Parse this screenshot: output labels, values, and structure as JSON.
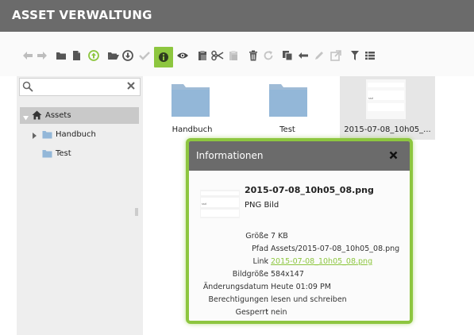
{
  "app": {
    "title": "ASSET VERWALTUNG"
  },
  "colors": {
    "accent": "#8dc63f",
    "header": "#6b6b6b",
    "sidebar": "#eeeeee"
  },
  "toolbar": {
    "buttons": [
      "back-icon",
      "forward-icon",
      "folder-icon",
      "file-icon",
      "upload-icon",
      "folder-open-icon",
      "download-icon",
      "check-icon",
      "info-icon",
      "eye-icon",
      "paste-icon",
      "cut-icon",
      "paste-disabled-icon",
      "trash-icon",
      "refresh-icon",
      "copy-icon",
      "rename-icon",
      "edit-icon",
      "resize-icon",
      "filter-icon",
      "list-view-icon"
    ],
    "active": "info-icon"
  },
  "sidebar": {
    "search": {
      "placeholder": "",
      "value": ""
    },
    "tree": {
      "root": {
        "label": "Assets",
        "expanded": true
      },
      "children": [
        {
          "label": "Handbuch",
          "has_children": true
        },
        {
          "label": "Test",
          "has_children": false
        }
      ]
    }
  },
  "files": [
    {
      "name": "Handbuch",
      "kind": "folder"
    },
    {
      "name": "Test",
      "kind": "folder"
    },
    {
      "name": "2015-07-08_10h05_...",
      "kind": "image",
      "selected": true
    }
  ],
  "dialog": {
    "title": "Informationen",
    "file_name": "2015-07-08_10h05_08.png",
    "file_type": "PNG Bild",
    "properties": [
      {
        "label": "Größe",
        "value": "7 KB",
        "link": false
      },
      {
        "label": "Pfad",
        "value": "Assets/2015-07-08_10h05_08.png",
        "link": false
      },
      {
        "label": "Link",
        "value": "2015-07-08_10h05_08.png",
        "link": true
      },
      {
        "label": "Bildgröße",
        "value": "584x147",
        "link": false
      },
      {
        "label": "Änderungsdatum",
        "value": "Heute 01:09 PM",
        "link": false
      },
      {
        "label": "Berechtigungen",
        "value": "lesen und schreiben",
        "link": false
      },
      {
        "label": "Gesperrt",
        "value": "nein",
        "link": false
      }
    ]
  }
}
